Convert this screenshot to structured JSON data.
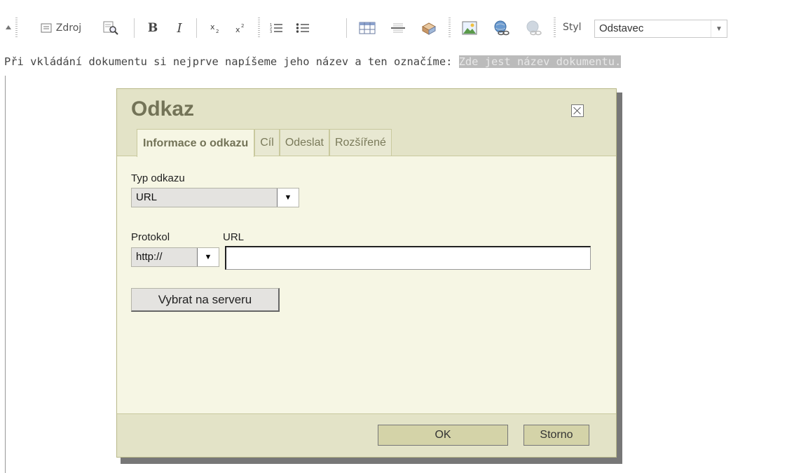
{
  "toolbar": {
    "source_label": "Zdroj",
    "style_label": "Styl",
    "style_value": "Odstavec",
    "bold": "B",
    "italic": "I"
  },
  "editor": {
    "text": "Při vkládání dokumentu si nejprve napíšeme jeho název a ten označíme: ",
    "selected_text": "Zde jest název dokumentu."
  },
  "dialog": {
    "title": "Odkaz",
    "tabs": [
      {
        "label": "Informace o odkazu"
      },
      {
        "label": "Cíl"
      },
      {
        "label": "Odeslat"
      },
      {
        "label": "Rozšířené"
      }
    ],
    "link_type_label": "Typ odkazu",
    "link_type_value": "URL",
    "protocol_label": "Protokol",
    "protocol_value": "http://",
    "url_label": "URL",
    "url_value": "",
    "browse_button": "Vybrat na serveru",
    "ok_button": "OK",
    "cancel_button": "Storno"
  },
  "icons": [
    "collapse-icon",
    "source-icon",
    "preview-icon",
    "bold-icon",
    "italic-icon",
    "subscript-icon",
    "superscript-icon",
    "numbered-list-icon",
    "bulleted-list-icon",
    "table-icon",
    "horizontal-rule-icon",
    "special-char-icon",
    "image-icon",
    "link-icon",
    "unlink-icon",
    "dropdown-arrow-icon",
    "close-icon"
  ],
  "colors": {
    "dialog_header": "#e3e3c7",
    "dialog_body": "#f6f6e4",
    "title_text": "#737357",
    "selection": "#bbbbbb"
  }
}
